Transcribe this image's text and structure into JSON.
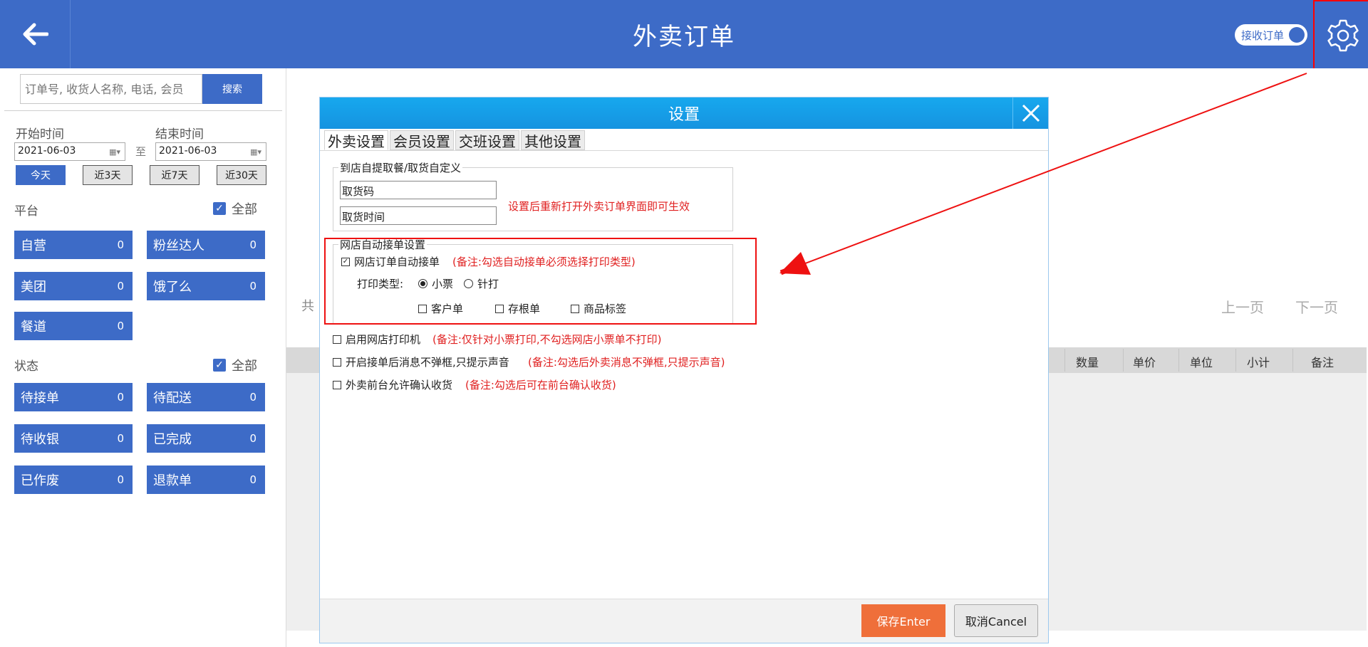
{
  "header": {
    "title": "外卖订单",
    "toggle_label": "接收订单"
  },
  "search": {
    "placeholder": "订单号, 收货人名称, 电话, 会员",
    "button_label": "搜索"
  },
  "date_filter": {
    "start_label": "开始时间",
    "end_label": "结束时间",
    "start_value": "2021-06-03",
    "end_value": "2021-06-03",
    "separator": "至",
    "quick_buttons": [
      "今天",
      "近3天",
      "近7天",
      "近30天"
    ]
  },
  "platform": {
    "heading": "平台",
    "all_label": "全部",
    "items": [
      {
        "label": "自营",
        "count": "0"
      },
      {
        "label": "粉丝达人",
        "count": "0"
      },
      {
        "label": "美团",
        "count": "0"
      },
      {
        "label": "饿了么",
        "count": "0"
      },
      {
        "label": "餐道",
        "count": "0"
      }
    ]
  },
  "status": {
    "heading": "状态",
    "all_label": "全部",
    "items": [
      {
        "label": "待接单",
        "count": "0"
      },
      {
        "label": "待配送",
        "count": "0"
      },
      {
        "label": "待收银",
        "count": "0"
      },
      {
        "label": "已完成",
        "count": "0"
      },
      {
        "label": "已作废",
        "count": "0"
      },
      {
        "label": "退款单",
        "count": "0"
      }
    ]
  },
  "list": {
    "total_prefix": "共",
    "prev_page": "上一页",
    "next_page": "下一页",
    "columns": [
      "数量",
      "单价",
      "单位",
      "小计",
      "备注"
    ]
  },
  "dialog": {
    "title": "设置",
    "tabs": [
      "外卖设置",
      "会员设置",
      "交班设置",
      "其他设置"
    ],
    "pickup_group": {
      "title": "到店自提取餐/取货自定义",
      "field1_value": "取货码",
      "field2_value": "取货时间",
      "note": "设置后重新打开外卖订单界面即可生效"
    },
    "auto_accept_group": {
      "title": "网店自动接单设置",
      "auto_accept_label": "网店订单自动接单",
      "auto_accept_note": "(备注:勾选自动接单必须选择打印类型)",
      "print_type_label": "打印类型:",
      "radio_receipt": "小票",
      "radio_dot": "针打",
      "check_customer": "客户单",
      "check_stub": "存根单",
      "check_label": "商品标签"
    },
    "options": [
      {
        "label": "启用网店打印机",
        "note": "(备注:仅针对小票打印,不勾选网店小票单不打印)"
      },
      {
        "label": "开启接单后消息不弹框,只提示声音",
        "note": "(备注:勾选后外卖消息不弹框,只提示声音)"
      },
      {
        "label": "外卖前台允许确认收货",
        "note": "(备注:勾选后可在前台确认收货)"
      }
    ],
    "save_label": "保存Enter",
    "cancel_label": "取消Cancel"
  }
}
